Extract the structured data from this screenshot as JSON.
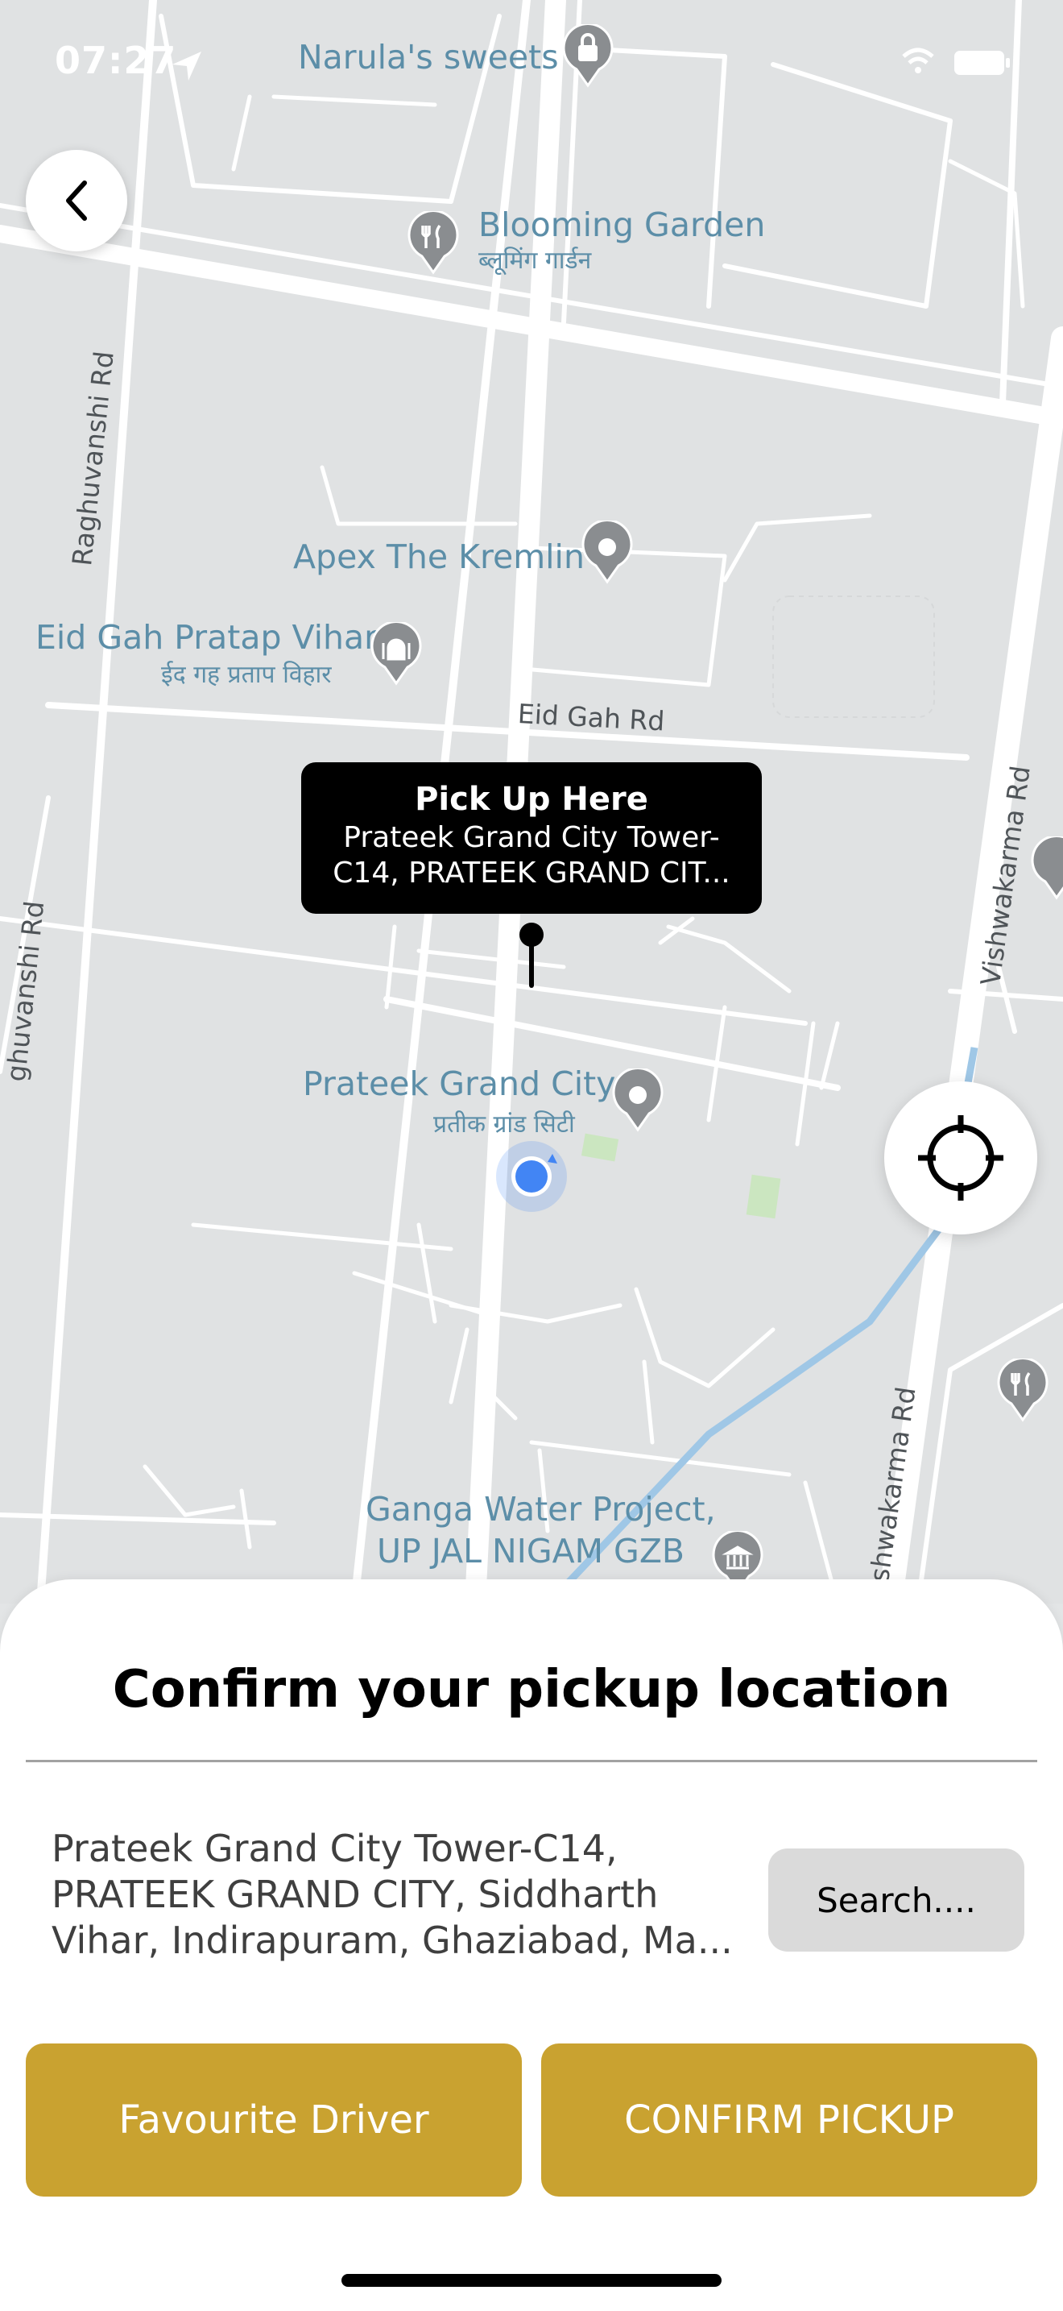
{
  "status_bar": {
    "time": "07:27"
  },
  "map": {
    "pois": [
      {
        "name": "Narula's sweets",
        "icon": "lock-bag-icon"
      },
      {
        "name": "Blooming Garden",
        "sub": "ब्लूमिंग गार्डन",
        "icon": "restaurant-icon"
      },
      {
        "name": "Apex The Kremlin",
        "icon": "place-icon"
      },
      {
        "name": "Eid Gah Pratap Vihar",
        "sub": "ईद गह प्रताप विहार",
        "icon": "mosque-icon"
      },
      {
        "name": "Prateek Grand City",
        "sub": "प्रतीक ग्रांड सिटी",
        "icon": "place-icon"
      },
      {
        "name": "Ganga Water Project,",
        "sub": "UP JAL NIGAM GZB",
        "icon": "building-icon"
      }
    ],
    "roads": [
      "Raghuvanshi Rd",
      "Eid Gah Rd",
      "Vishwakarma Rd",
      "ghuvanshi Rd",
      "shwakarma Rd"
    ]
  },
  "pickup_tooltip": {
    "title": "Pick Up Here",
    "address": "Prateek Grand City Tower-C14, PRATEEK GRAND CIT..."
  },
  "sheet": {
    "title": "Confirm your pickup location",
    "address": "Prateek Grand City Tower-C14, PRATEEK GRAND CITY, Siddharth Vihar, Indirapuram, Ghaziabad, Ma...",
    "search_label": "Search....",
    "favourite_label": "Favourite Driver",
    "confirm_label": "CONFIRM PICKUP"
  },
  "colors": {
    "accent": "#c9a230",
    "map_bg": "#e0e2e3",
    "poi_text": "#5c8ea8",
    "user_dot": "#4285f4"
  }
}
